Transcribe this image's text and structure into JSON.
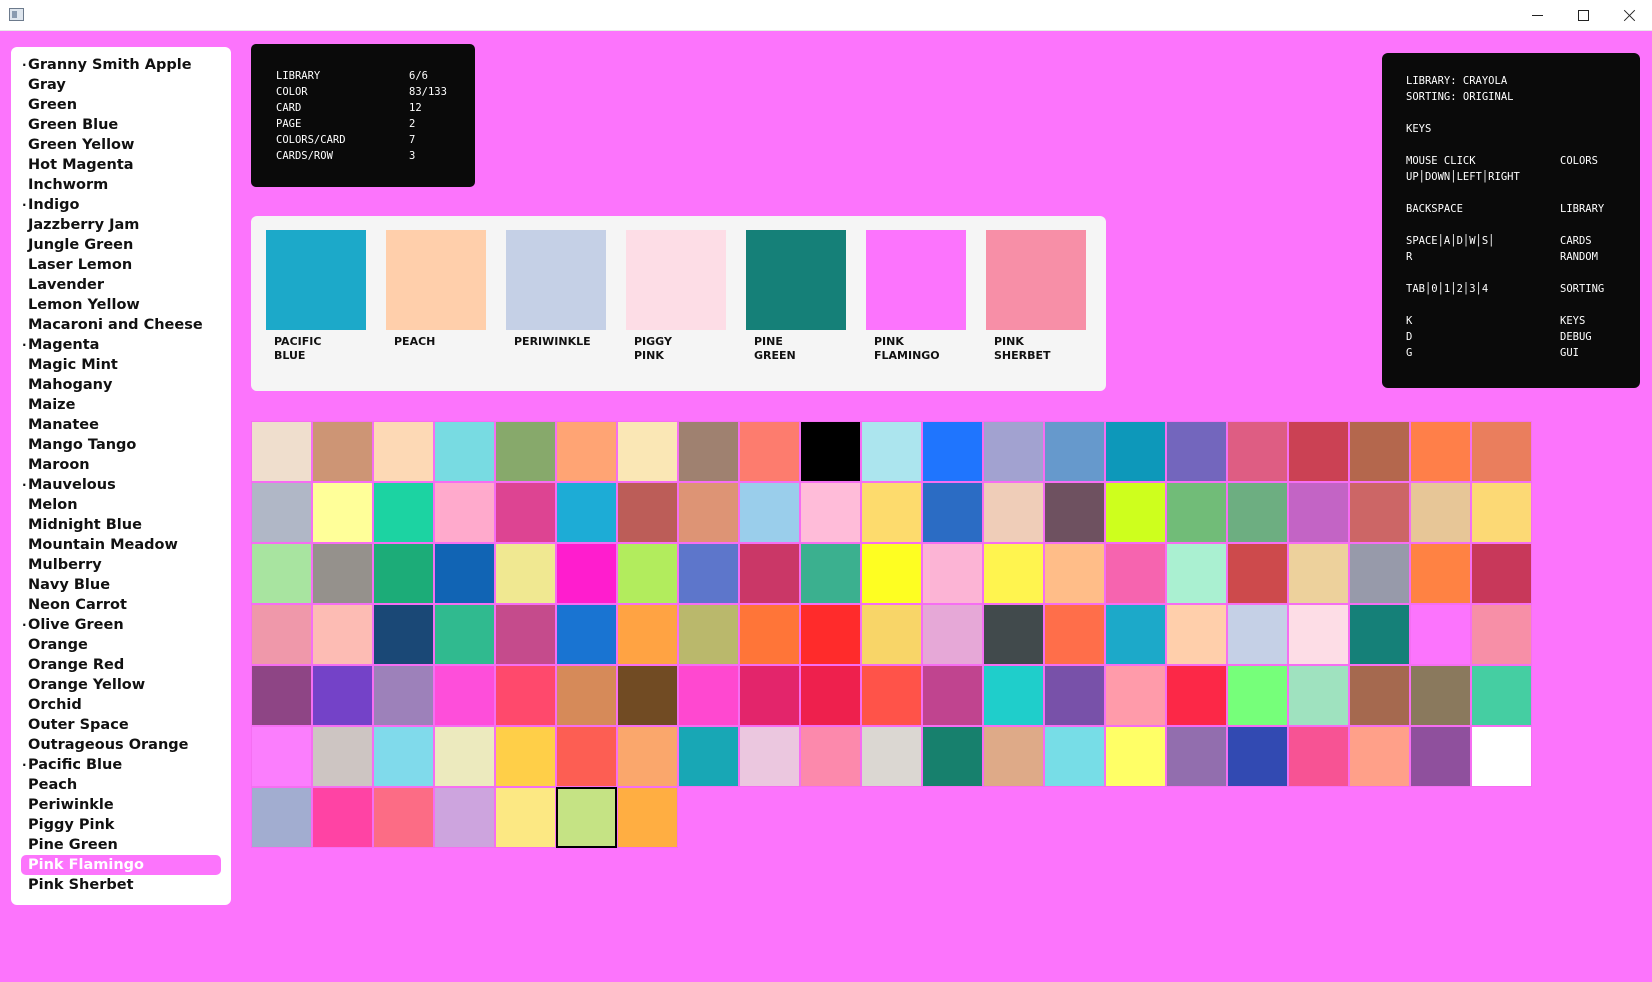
{
  "window": {
    "title": ""
  },
  "sidebar": {
    "items": [
      {
        "label": "Granny Smith Apple",
        "bullet": true
      },
      {
        "label": "Gray"
      },
      {
        "label": "Green"
      },
      {
        "label": "Green Blue"
      },
      {
        "label": "Green Yellow"
      },
      {
        "label": "Hot Magenta"
      },
      {
        "label": "Inchworm"
      },
      {
        "label": "Indigo",
        "bullet": true
      },
      {
        "label": "Jazzberry Jam"
      },
      {
        "label": "Jungle Green"
      },
      {
        "label": "Laser Lemon"
      },
      {
        "label": "Lavender"
      },
      {
        "label": "Lemon Yellow"
      },
      {
        "label": "Macaroni and Cheese"
      },
      {
        "label": "Magenta",
        "bullet": true
      },
      {
        "label": "Magic Mint"
      },
      {
        "label": "Mahogany"
      },
      {
        "label": "Maize"
      },
      {
        "label": "Manatee"
      },
      {
        "label": "Mango Tango"
      },
      {
        "label": "Maroon"
      },
      {
        "label": "Mauvelous",
        "bullet": true
      },
      {
        "label": "Melon"
      },
      {
        "label": "Midnight Blue"
      },
      {
        "label": "Mountain Meadow"
      },
      {
        "label": "Mulberry"
      },
      {
        "label": "Navy Blue"
      },
      {
        "label": "Neon Carrot"
      },
      {
        "label": "Olive Green",
        "bullet": true
      },
      {
        "label": "Orange"
      },
      {
        "label": "Orange Red"
      },
      {
        "label": "Orange Yellow"
      },
      {
        "label": "Orchid"
      },
      {
        "label": "Outer Space"
      },
      {
        "label": "Outrageous Orange"
      },
      {
        "label": "Pacific Blue",
        "bullet": true
      },
      {
        "label": "Peach"
      },
      {
        "label": "Periwinkle"
      },
      {
        "label": "Piggy Pink"
      },
      {
        "label": "Pine Green"
      },
      {
        "label": "Pink Flamingo",
        "selected": true
      },
      {
        "label": "Pink Sherbet"
      }
    ],
    "bullet_glyph": "·"
  },
  "stats": {
    "rows": [
      {
        "key": "LIBRARY",
        "value": "6/6"
      },
      {
        "key": "COLOR",
        "value": "83/133"
      },
      {
        "key": "CARD",
        "value": "12"
      },
      {
        "key": "PAGE",
        "value": "2"
      },
      {
        "key": "COLORS/CARD",
        "value": "7"
      },
      {
        "key": "CARDS/ROW",
        "value": "3"
      }
    ]
  },
  "keys_panel": {
    "library_line": "LIBRARY: CRAYOLA",
    "sorting_line": "SORTING: ORIGINAL",
    "keys_title": "KEYS",
    "groups": [
      {
        "lines": [
          {
            "key": "MOUSE CLICK",
            "action": "COLORS"
          },
          {
            "key": "UP│DOWN│LEFT│RIGHT",
            "action": ""
          }
        ]
      },
      {
        "lines": [
          {
            "key": "BACKSPACE",
            "action": "LIBRARY"
          }
        ]
      },
      {
        "lines": [
          {
            "key": "SPACE│A│D│W│S│",
            "action": "CARDS"
          },
          {
            "key": "R",
            "action": "RANDOM"
          }
        ]
      },
      {
        "lines": [
          {
            "key": "TAB│0│1│2│3│4",
            "action": "SORTING"
          }
        ]
      },
      {
        "lines": [
          {
            "key": "K",
            "action": "KEYS"
          },
          {
            "key": "D",
            "action": "DEBUG"
          },
          {
            "key": "G",
            "action": "GUI"
          }
        ]
      }
    ]
  },
  "card": {
    "swatches": [
      {
        "name": "PACIFIC BLUE",
        "color": "#1CA9C9"
      },
      {
        "name": "PEACH",
        "color": "#FFCFAB"
      },
      {
        "name": "PERIWINKLE",
        "color": "#C5D0E6"
      },
      {
        "name": "PIGGY PINK",
        "color": "#FDDDE6"
      },
      {
        "name": "PINE GREEN",
        "color": "#158078"
      },
      {
        "name": "PINK FLAMINGO",
        "color": "#FC74FD"
      },
      {
        "name": "PINK SHERBET",
        "color": "#F78FA7"
      }
    ]
  },
  "grid": {
    "current_index": 131,
    "colors": [
      "#EFDECD",
      "#CD9575",
      "#FDD9B5",
      "#78DBE2",
      "#87A96B",
      "#FFA474",
      "#FAE7B5",
      "#9F8170",
      "#FD7C6E",
      "#000000",
      "#ACE5EE",
      "#1F75FE",
      "#A2A2D0",
      "#6699CC",
      "#0D98BA",
      "#7366BD",
      "#DE5D83",
      "#CB4154",
      "#B4674D",
      "#FF7F49",
      "#EA7E5D",
      "#B0B7C6",
      "#FFFF99",
      "#1CD3A2",
      "#FFAACC",
      "#DD4492",
      "#1DACD6",
      "#BC5D58",
      "#DD9475",
      "#9ACEEB",
      "#FFBCD9",
      "#FDDB6D",
      "#2B6CC4",
      "#EFCDB8",
      "#6E5160",
      "#CEFF1D",
      "#71BC78",
      "#6DAE81",
      "#C364C5",
      "#CC6666",
      "#E7C697",
      "#FCD975",
      "#A8E4A0",
      "#95918C",
      "#1CAC78",
      "#1164B4",
      "#F0E891",
      "#FF1DCE",
      "#B2EC5D",
      "#5D76CB",
      "#CA3767",
      "#3BB08F",
      "#FEFE22",
      "#FCB4D5",
      "#FFF44F",
      "#FFBD88",
      "#F664AF",
      "#AAF0D1",
      "#CD4A4C",
      "#EDD19C",
      "#979AAA",
      "#FF8243",
      "#C8385A",
      "#EF98AA",
      "#FDBCB4",
      "#1A4876",
      "#30BA8F",
      "#C54B8C",
      "#1974D2",
      "#FFA343",
      "#BAB86C",
      "#FF7538",
      "#FF2B2B",
      "#F8D568",
      "#E6A8D7",
      "#414A4C",
      "#FF6E4A",
      "#1CA9C9",
      "#FFCFAB",
      "#C5D0E6",
      "#FDDDE6",
      "#158078",
      "#FC74FD",
      "#F78FA7",
      "#8E4585",
      "#7442C8",
      "#9D81BA",
      "#FE4EDA",
      "#FF496C",
      "#D68A59",
      "#714B23",
      "#FF48D0",
      "#E3256B",
      "#EE204D",
      "#FF5349",
      "#C0448F",
      "#1FCECB",
      "#7851A9",
      "#FF9BAA",
      "#FC2847",
      "#76FF7A",
      "#9FE2BF",
      "#A5694F",
      "#8A795D",
      "#45CEA2",
      "#FB7EFD",
      "#CDC5C2",
      "#80DAEB",
      "#ECEABE",
      "#FFCF48",
      "#FD5E53",
      "#FAA76C",
      "#18A7B5",
      "#EBC7DF",
      "#FC89AC",
      "#DBD7D2",
      "#17806D",
      "#DEAA88",
      "#77DDE7",
      "#FFFF66",
      "#926EAE",
      "#324AB2",
      "#F75394",
      "#FFA089",
      "#8F509D",
      "#FFFFFF",
      "#A2ADD0",
      "#FF43A4",
      "#FC6C85",
      "#CDA4DE",
      "#FCE883",
      "#C5E384",
      "#FFAE42"
    ]
  }
}
